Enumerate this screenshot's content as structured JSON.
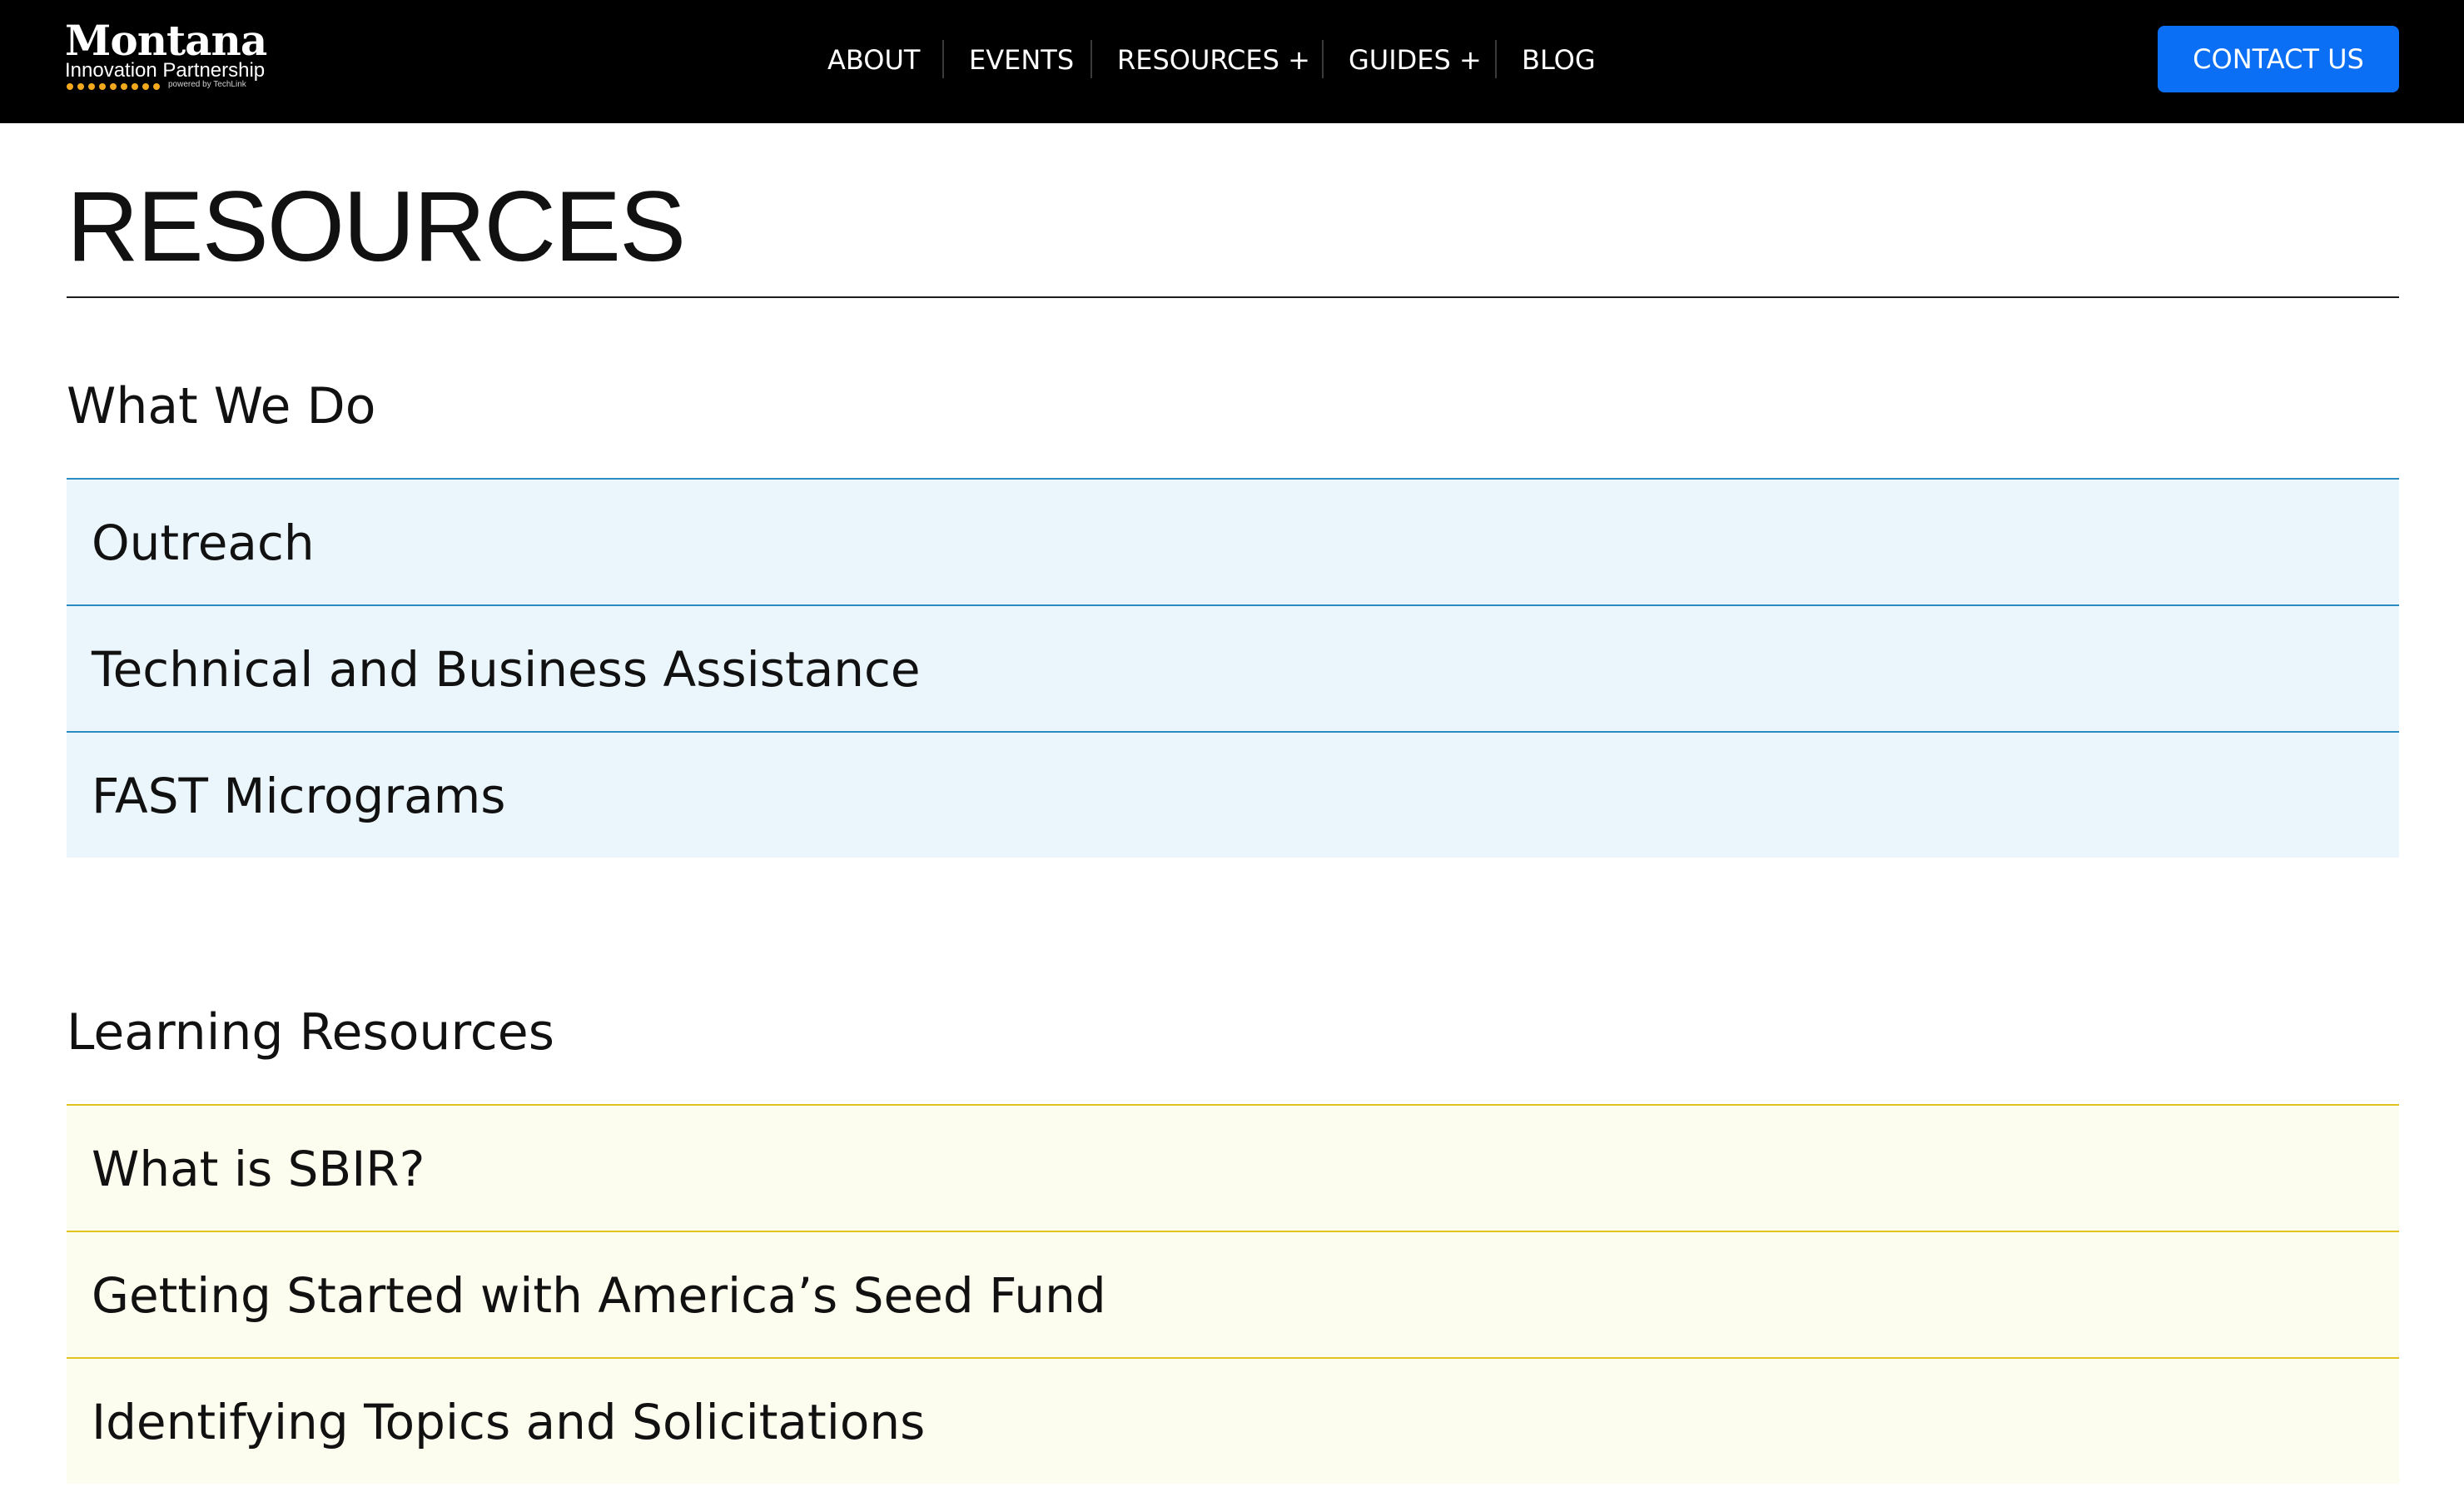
{
  "header": {
    "logo": {
      "name": "Montana",
      "subtitle": "Innovation Partnership",
      "tagline": "powered by TechLink",
      "dot_color": "#f2a91d"
    },
    "nav": [
      {
        "label": "ABOUT"
      },
      {
        "label": "EVENTS"
      },
      {
        "label": "RESOURCES +"
      },
      {
        "label": "GUIDES +"
      },
      {
        "label": "BLOG"
      }
    ],
    "contact_label": "CONTACT US",
    "accent_color": "#0b6ff5"
  },
  "page": {
    "title": "RESOURCES"
  },
  "sections": [
    {
      "heading": "What We Do",
      "theme_color": "#2a8cc0",
      "items": [
        {
          "label": "Outreach"
        },
        {
          "label": "Technical and Business Assistance"
        },
        {
          "label": "FAST Micrograms"
        }
      ]
    },
    {
      "heading": "Learning Resources",
      "theme_color": "#e2c21c",
      "items": [
        {
          "label": "What is SBIR?"
        },
        {
          "label": "Getting Started with America’s Seed Fund"
        },
        {
          "label": "Identifying Topics and Solicitations"
        }
      ]
    }
  ]
}
